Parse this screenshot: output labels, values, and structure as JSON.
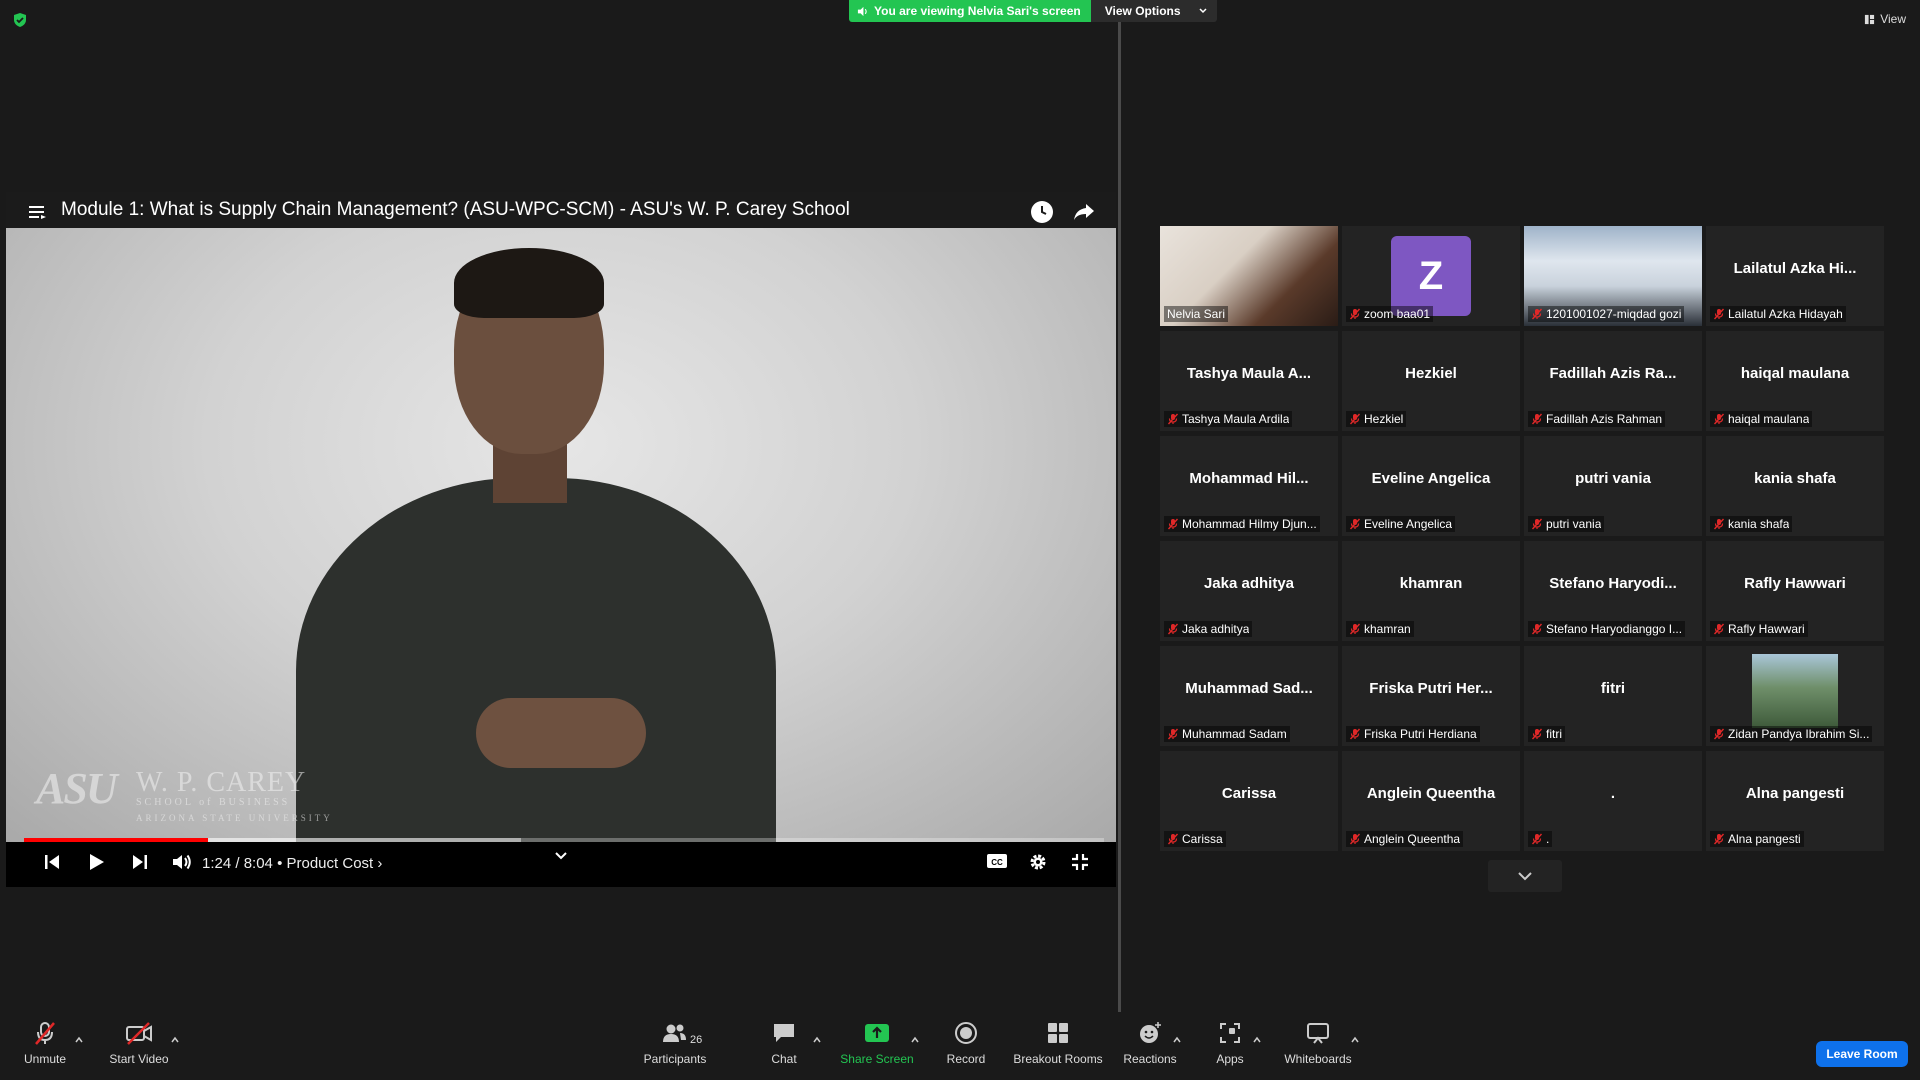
{
  "banner": {
    "viewing_text": "You are viewing Nelvia Sari's screen",
    "view_options": "View Options",
    "view_button": "View",
    "accent": "#23c552"
  },
  "video": {
    "title": "Module 1: What is Supply Chain Management? (ASU-WPC-SCM) - ASU's W. P. Carey School",
    "time": "1:24 / 8:04",
    "chapter": "• Product Cost",
    "played_fraction": 0.17,
    "loaded_fraction": 0.46,
    "logo_main": "ASU",
    "logo_wp": "W. P. CAREY",
    "logo_sub": "SCHOOL of BUSINESS",
    "logo_sub2": "ARIZONA STATE UNIVERSITY"
  },
  "gallery": {
    "participants": [
      {
        "display": "",
        "label": "Nelvia Sari",
        "type": "photo",
        "active": true
      },
      {
        "display": "Z",
        "label": "zoom baa01",
        "type": "avatar"
      },
      {
        "display": "",
        "label": "1201001027-miqdad gozi",
        "type": "photo2"
      },
      {
        "display": "Lailatul Azka Hi...",
        "label": "Lailatul Azka Hidayah",
        "type": "text"
      },
      {
        "display": "Tashya Maula A...",
        "label": "Tashya Maula Ardila",
        "type": "text"
      },
      {
        "display": "Hezkiel",
        "label": "Hezkiel",
        "type": "text"
      },
      {
        "display": "Fadillah Azis Ra...",
        "label": "Fadillah Azis Rahman",
        "type": "text"
      },
      {
        "display": "haiqal maulana",
        "label": "haiqal maulana",
        "type": "text"
      },
      {
        "display": "Mohammad Hil...",
        "label": "Mohammad Hilmy Djun...",
        "type": "text"
      },
      {
        "display": "Eveline Angelica",
        "label": "Eveline Angelica",
        "type": "text"
      },
      {
        "display": "putri vania",
        "label": "putri vania",
        "type": "text"
      },
      {
        "display": "kania shafa",
        "label": "kania shafa",
        "type": "text"
      },
      {
        "display": "Jaka adhitya",
        "label": "Jaka adhitya",
        "type": "text"
      },
      {
        "display": "khamran",
        "label": "khamran",
        "type": "text"
      },
      {
        "display": "Stefano Haryodi...",
        "label": "Stefano Haryodianggo I...",
        "type": "text"
      },
      {
        "display": "Rafly Hawwari",
        "label": "Rafly Hawwari",
        "type": "text"
      },
      {
        "display": "Muhammad Sad...",
        "label": "Muhammad Sadam",
        "type": "text"
      },
      {
        "display": "Friska Putri Her...",
        "label": "Friska Putri Herdiana",
        "type": "text"
      },
      {
        "display": "fitri",
        "label": "fitri",
        "type": "text"
      },
      {
        "display": "",
        "label": "Zidan Pandya Ibrahim Si...",
        "type": "thumb"
      },
      {
        "display": "Carissa",
        "label": "Carissa",
        "type": "text"
      },
      {
        "display": "Anglein Queentha",
        "label": "Anglein Queentha",
        "type": "text"
      },
      {
        "display": ".",
        "label": ".",
        "type": "text"
      },
      {
        "display": "Alna pangesti",
        "label": "Alna pangesti",
        "type": "text"
      }
    ]
  },
  "toolbar": {
    "unmute": "Unmute",
    "start_video": "Start Video",
    "participants": "Participants",
    "participant_count": "26",
    "chat": "Chat",
    "share_screen": "Share Screen",
    "record": "Record",
    "breakout_rooms": "Breakout Rooms",
    "reactions": "Reactions",
    "apps": "Apps",
    "whiteboards": "Whiteboards",
    "leave": "Leave Room",
    "leave_color": "#0e71eb",
    "share_color": "#23c552"
  }
}
